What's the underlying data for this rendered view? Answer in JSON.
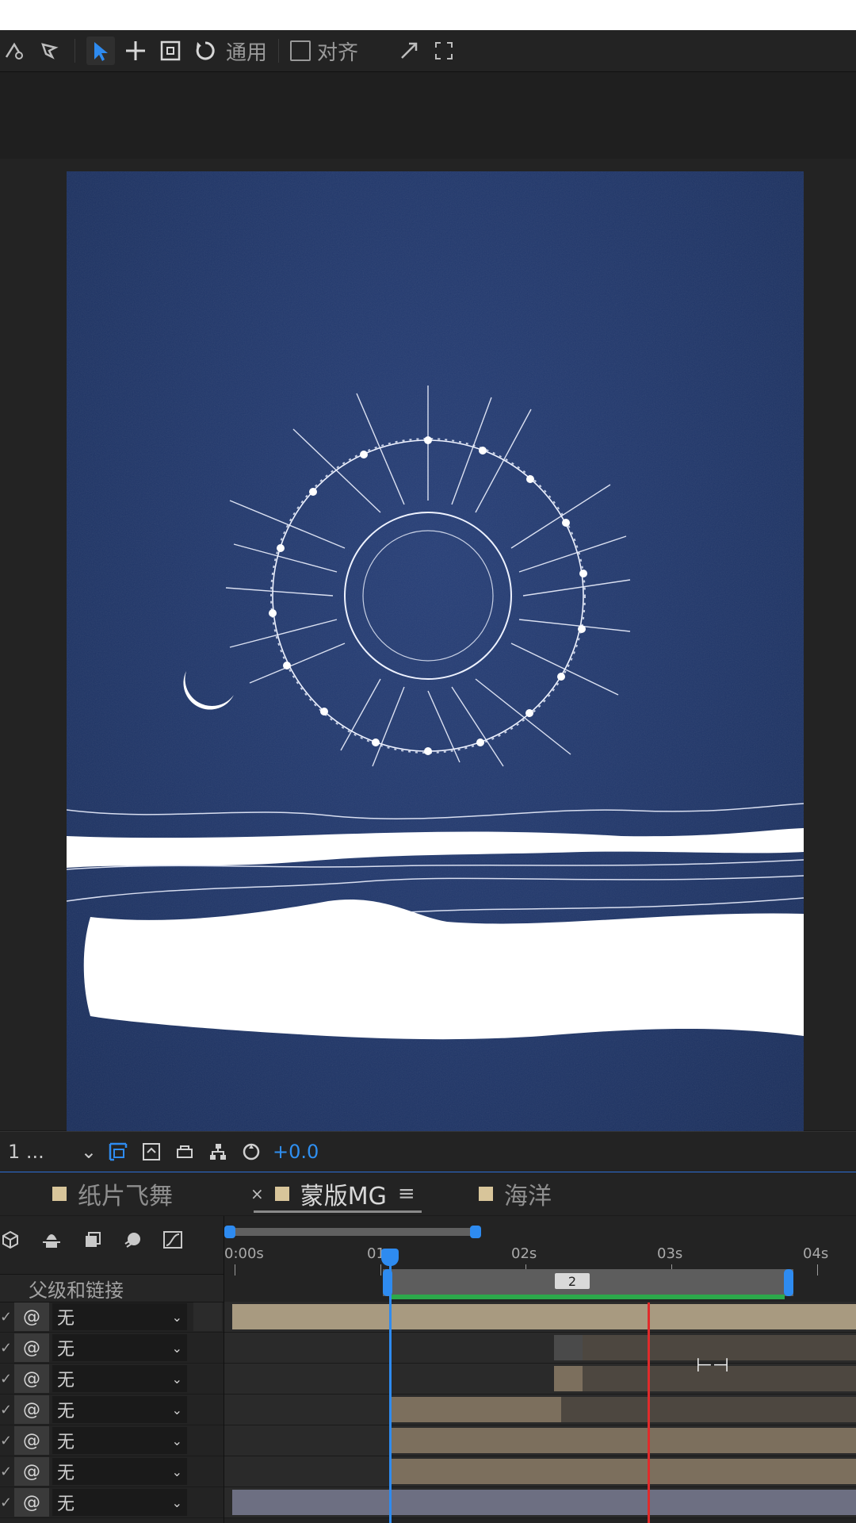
{
  "toolbar": {
    "workspace_label": "通用",
    "align_label": "对齐"
  },
  "viewer_bar": {
    "resolution": "1 ...",
    "exposure": "+0.0"
  },
  "tabs": [
    {
      "label": "纸片飞舞"
    },
    {
      "label": "蒙版MG",
      "close": "×",
      "menu": "≡"
    },
    {
      "label": "海洋"
    }
  ],
  "timeline": {
    "parent_header": "父级和链接",
    "ruler": [
      "0:00s",
      "01s",
      "02s",
      "03s",
      "04s"
    ],
    "marker_label": "2",
    "rows": [
      {
        "parent": "无"
      },
      {
        "parent": "无"
      },
      {
        "parent": "无"
      },
      {
        "parent": "无"
      },
      {
        "parent": "无"
      },
      {
        "parent": "无"
      },
      {
        "parent": "无"
      }
    ]
  },
  "colors": {
    "canvas": "#1e3466",
    "accent": "#2e8bf0",
    "layer_bar": "#7c6f5d",
    "work_area_green": "#2ca94b",
    "current_time_red": "#e02b2b"
  },
  "icons": {
    "select_tool": "selection-arrow-icon",
    "move_tool": "move-cross-icon",
    "mask_tool": "rectangle-mask-icon",
    "rotate_tool": "rotate-icon"
  }
}
